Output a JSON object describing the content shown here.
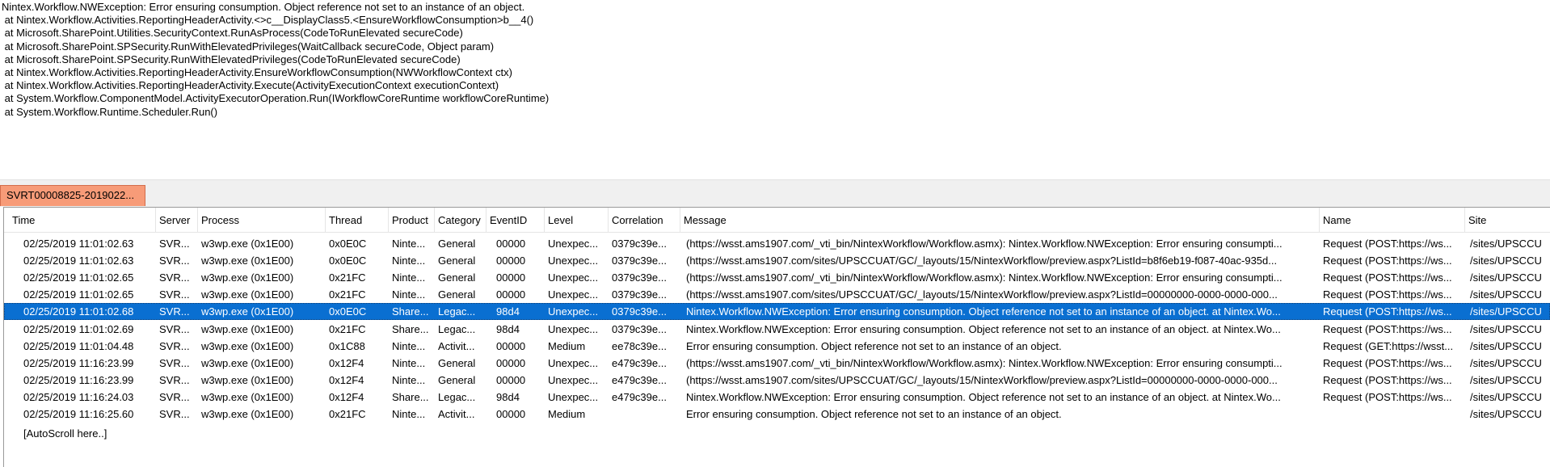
{
  "detail": {
    "lines": [
      "Nintex.Workflow.NWException: Error ensuring consumption. Object reference not set to an instance of an object.",
      " at Nintex.Workflow.Activities.ReportingHeaderActivity.<>c__DisplayClass5.<EnsureWorkflowConsumption>b__4()",
      " at Microsoft.SharePoint.Utilities.SecurityContext.RunAsProcess(CodeToRunElevated secureCode)",
      " at Microsoft.SharePoint.SPSecurity.RunWithElevatedPrivileges(WaitCallback secureCode, Object param)",
      " at Microsoft.SharePoint.SPSecurity.RunWithElevatedPrivileges(CodeToRunElevated secureCode)",
      " at Nintex.Workflow.Activities.ReportingHeaderActivity.EnsureWorkflowConsumption(NWWorkflowContext ctx)",
      " at Nintex.Workflow.Activities.ReportingHeaderActivity.Execute(ActivityExecutionContext executionContext)",
      " at System.Workflow.ComponentModel.ActivityExecutorOperation.Run(IWorkflowCoreRuntime workflowCoreRuntime)",
      " at System.Workflow.Runtime.Scheduler.Run()"
    ]
  },
  "tab": {
    "label": "SVRT00008825-2019022..."
  },
  "grid": {
    "columns": {
      "time": "Time",
      "server": "Server",
      "process": "Process",
      "thread": "Thread",
      "product": "Product",
      "category": "Category",
      "eventid": "EventID",
      "level": "Level",
      "correlation": "Correlation",
      "message": "Message",
      "name": "Name",
      "site": "Site"
    },
    "rows": [
      {
        "time": "02/25/2019 11:01:02.63",
        "server": "SVR...",
        "process": "w3wp.exe (0x1E00)",
        "thread": "0x0E0C",
        "product": "Ninte...",
        "category": "General",
        "eventid": "00000",
        "level": "Unexpec...",
        "correlation": "0379c39e...",
        "message": "(https://wsst.ams1907.com/_vti_bin/NintexWorkflow/Workflow.asmx): Nintex.Workflow.NWException: Error ensuring consumpti...",
        "name": "Request (POST:https://ws...",
        "site": "/sites/UPSCCU"
      },
      {
        "time": "02/25/2019 11:01:02.63",
        "server": "SVR...",
        "process": "w3wp.exe (0x1E00)",
        "thread": "0x0E0C",
        "product": "Ninte...",
        "category": "General",
        "eventid": "00000",
        "level": "Unexpec...",
        "correlation": "0379c39e...",
        "message": "(https://wsst.ams1907.com/sites/UPSCCUAT/GC/_layouts/15/NintexWorkflow/preview.aspx?ListId=b8f6eb19-f087-40ac-935d...",
        "name": "Request (POST:https://ws...",
        "site": "/sites/UPSCCU"
      },
      {
        "time": "02/25/2019 11:01:02.65",
        "server": "SVR...",
        "process": "w3wp.exe (0x1E00)",
        "thread": "0x21FC",
        "product": "Ninte...",
        "category": "General",
        "eventid": "00000",
        "level": "Unexpec...",
        "correlation": "0379c39e...",
        "message": "(https://wsst.ams1907.com/_vti_bin/NintexWorkflow/Workflow.asmx): Nintex.Workflow.NWException: Error ensuring consumpti...",
        "name": "Request (POST:https://ws...",
        "site": "/sites/UPSCCU"
      },
      {
        "time": "02/25/2019 11:01:02.65",
        "server": "SVR...",
        "process": "w3wp.exe (0x1E00)",
        "thread": "0x21FC",
        "product": "Ninte...",
        "category": "General",
        "eventid": "00000",
        "level": "Unexpec...",
        "correlation": "0379c39e...",
        "message": "(https://wsst.ams1907.com/sites/UPSCCUAT/GC/_layouts/15/NintexWorkflow/preview.aspx?ListId=00000000-0000-0000-000...",
        "name": "Request (POST:https://ws...",
        "site": "/sites/UPSCCU"
      },
      {
        "time": "02/25/2019 11:01:02.68",
        "server": "SVR...",
        "process": "w3wp.exe (0x1E00)",
        "thread": "0x0E0C",
        "product": "Share...",
        "category": "Legac...",
        "eventid": "98d4",
        "level": "Unexpec...",
        "correlation": "0379c39e...",
        "message": "Nintex.Workflow.NWException: Error ensuring consumption. Object reference not set to an instance of an object.    at Nintex.Wo...",
        "name": "Request (POST:https://ws...",
        "site": "/sites/UPSCCU",
        "selected": true
      },
      {
        "time": "02/25/2019 11:01:02.69",
        "server": "SVR...",
        "process": "w3wp.exe (0x1E00)",
        "thread": "0x21FC",
        "product": "Share...",
        "category": "Legac...",
        "eventid": "98d4",
        "level": "Unexpec...",
        "correlation": "0379c39e...",
        "message": "Nintex.Workflow.NWException: Error ensuring consumption. Object reference not set to an instance of an object.    at Nintex.Wo...",
        "name": "Request (POST:https://ws...",
        "site": "/sites/UPSCCU"
      },
      {
        "time": "02/25/2019 11:01:04.48",
        "server": "SVR...",
        "process": "w3wp.exe (0x1E00)",
        "thread": "0x1C88",
        "product": "Ninte...",
        "category": "Activit...",
        "eventid": "00000",
        "level": "Medium",
        "correlation": "ee78c39e...",
        "message": "Error ensuring consumption. Object reference not set to an instance of an object.",
        "name": "Request (GET:https://wsst...",
        "site": "/sites/UPSCCU"
      },
      {
        "time": "02/25/2019 11:16:23.99",
        "server": "SVR...",
        "process": "w3wp.exe (0x1E00)",
        "thread": "0x12F4",
        "product": "Ninte...",
        "category": "General",
        "eventid": "00000",
        "level": "Unexpec...",
        "correlation": "e479c39e...",
        "message": "(https://wsst.ams1907.com/_vti_bin/NintexWorkflow/Workflow.asmx): Nintex.Workflow.NWException: Error ensuring consumpti...",
        "name": "Request (POST:https://ws...",
        "site": "/sites/UPSCCU"
      },
      {
        "time": "02/25/2019 11:16:23.99",
        "server": "SVR...",
        "process": "w3wp.exe (0x1E00)",
        "thread": "0x12F4",
        "product": "Ninte...",
        "category": "General",
        "eventid": "00000",
        "level": "Unexpec...",
        "correlation": "e479c39e...",
        "message": "(https://wsst.ams1907.com/sites/UPSCCUAT/GC/_layouts/15/NintexWorkflow/preview.aspx?ListId=00000000-0000-0000-000...",
        "name": "Request (POST:https://ws...",
        "site": "/sites/UPSCCU"
      },
      {
        "time": "02/25/2019 11:16:24.03",
        "server": "SVR...",
        "process": "w3wp.exe (0x1E00)",
        "thread": "0x12F4",
        "product": "Share...",
        "category": "Legac...",
        "eventid": "98d4",
        "level": "Unexpec...",
        "correlation": "e479c39e...",
        "message": "Nintex.Workflow.NWException: Error ensuring consumption. Object reference not set to an instance of an object.    at Nintex.Wo...",
        "name": "Request (POST:https://ws...",
        "site": "/sites/UPSCCU"
      },
      {
        "time": "02/25/2019 11:16:25.60",
        "server": "SVR...",
        "process": "w3wp.exe (0x1E00)",
        "thread": "0x21FC",
        "product": "Ninte...",
        "category": "Activit...",
        "eventid": "00000",
        "level": "Medium",
        "correlation": "",
        "message": "Error ensuring consumption. Object reference not set to an instance of an object.",
        "name": "",
        "site": "/sites/UPSCCU"
      }
    ],
    "autoscroll": "[AutoScroll here..]"
  },
  "colors": {
    "tab_bg": "#f79b78",
    "selection": "#0a6fd1"
  }
}
